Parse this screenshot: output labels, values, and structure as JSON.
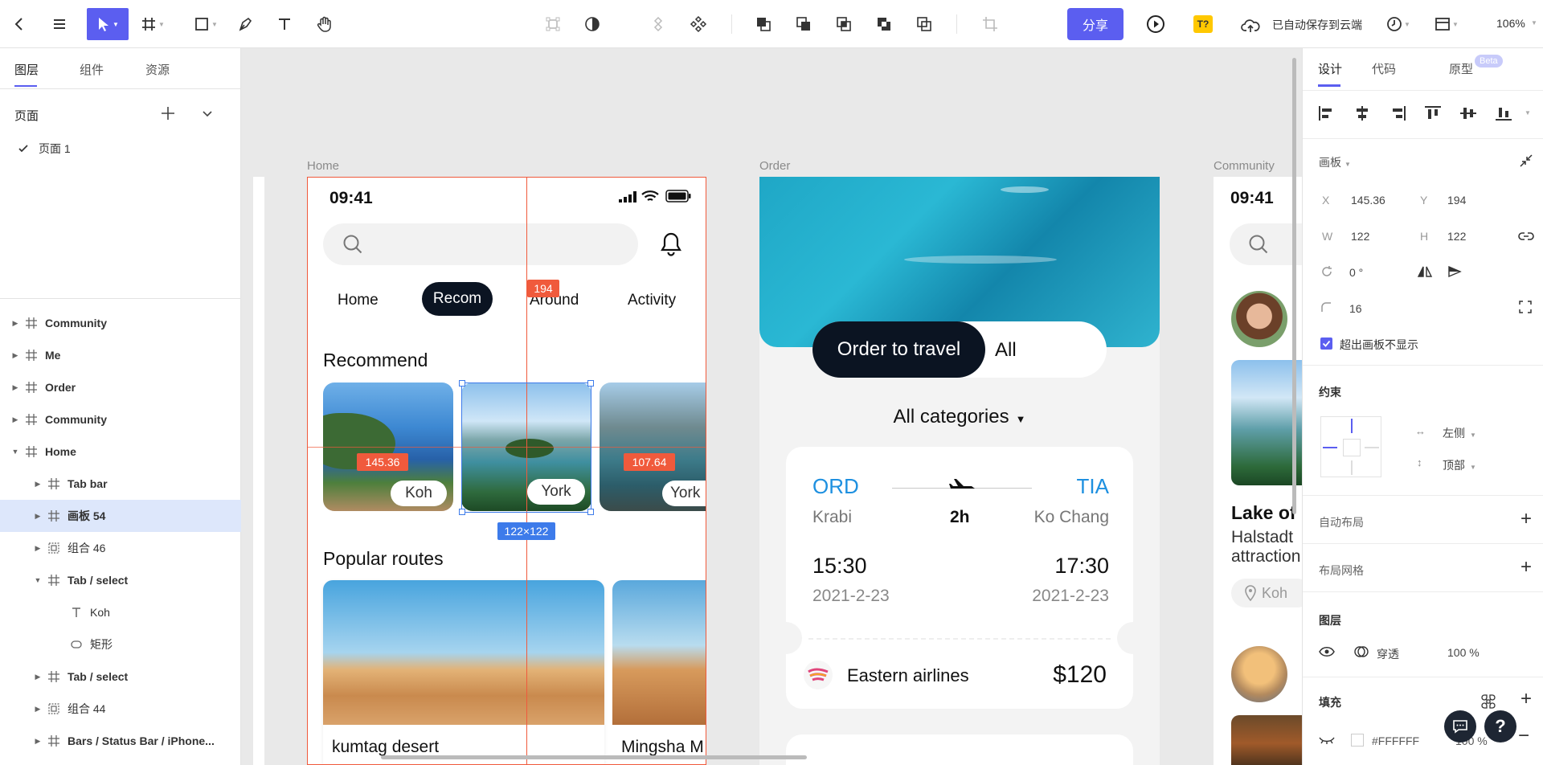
{
  "toolbar": {
    "share_label": "分享",
    "font_badge": "T?",
    "saved_status": "已自动保存到云端",
    "zoom": "106%"
  },
  "left_panel": {
    "tabs": [
      "图层",
      "组件",
      "资源"
    ],
    "pages_title": "页面",
    "pages": [
      "页面 1"
    ],
    "layers": [
      {
        "name": "Community",
        "type": "frame",
        "indent": 0,
        "expanded": false
      },
      {
        "name": "Me",
        "type": "frame",
        "indent": 0,
        "expanded": false
      },
      {
        "name": "Order",
        "type": "frame",
        "indent": 0,
        "expanded": false
      },
      {
        "name": "Community",
        "type": "frame",
        "indent": 0,
        "expanded": false
      },
      {
        "name": "Home",
        "type": "frame",
        "indent": 0,
        "expanded": true
      },
      {
        "name": "Tab bar",
        "type": "frame",
        "indent": 1,
        "expanded": false
      },
      {
        "name": "画板 54",
        "type": "frame",
        "indent": 1,
        "expanded": false,
        "selected": true
      },
      {
        "name": "组合 46",
        "type": "group",
        "indent": 1,
        "expanded": false
      },
      {
        "name": "Tab / select",
        "type": "frame",
        "indent": 1,
        "expanded": true
      },
      {
        "name": "Koh",
        "type": "text",
        "indent": 2
      },
      {
        "name": "矩形",
        "type": "rect",
        "indent": 2
      },
      {
        "name": "Tab / select",
        "type": "frame",
        "indent": 1,
        "expanded": false
      },
      {
        "name": "组合 44",
        "type": "group",
        "indent": 1,
        "expanded": false
      },
      {
        "name": "Bars / Status Bar / iPhone...",
        "type": "frame",
        "indent": 1,
        "expanded": false
      }
    ]
  },
  "canvas": {
    "frames": [
      "Home",
      "Order",
      "Community"
    ],
    "home": {
      "time": "09:41",
      "tabs": [
        "Home",
        "Recom",
        "Around",
        "Activity"
      ],
      "recommend_title": "Recommend",
      "cards": [
        "Koh",
        "York",
        "York"
      ],
      "popular_title": "Popular routes",
      "routes": [
        "kumtag desert",
        "Mingsha M"
      ]
    },
    "order": {
      "toggle_active": "Order to travel",
      "toggle_other": "All",
      "categories": "All categories",
      "from_code": "ORD",
      "to_code": "TIA",
      "from_city": "Krabi",
      "duration": "2h",
      "to_city": "Ko Chang",
      "depart_time": "15:30",
      "arrive_time": "17:30",
      "depart_date": "2021-2-23",
      "arrive_date": "2021-2-23",
      "airline": "Eastern airlines",
      "price": "$120"
    },
    "community": {
      "time": "09:41",
      "post_title": "Lake of",
      "post_desc_1": "Halstadt",
      "post_desc_2": "attraction",
      "location": "Koh"
    },
    "measures": {
      "top": "194",
      "left": "145.36",
      "right": "107.64",
      "size": "122×122"
    }
  },
  "right_panel": {
    "tabs": [
      "设计",
      "代码",
      "原型"
    ],
    "beta": "Beta",
    "section_frame": "画板",
    "x_label": "X",
    "x": "145.36",
    "y_label": "Y",
    "y": "194",
    "w_label": "W",
    "w": "122",
    "h_label": "H",
    "h": "122",
    "rotation": "0 °",
    "radius": "16",
    "clip_label": "超出画板不显示",
    "constraints_title": "约束",
    "constraint_h": "左侧",
    "constraint_v": "顶部",
    "auto_layout": "自动布局",
    "layout_grid": "布局网格",
    "layer_title": "图层",
    "blend": "穿透",
    "opacity": "100 %",
    "fill_title": "填充",
    "fill_hex": "#FFFFFF",
    "fill_opacity": "100 %"
  },
  "colors": {
    "accent": "#5B5EF0",
    "selection": "#F05A3C",
    "measure_blue": "#3D7BE8",
    "dark_pill": "#0B1422",
    "flight_code": "#1E90E0"
  }
}
